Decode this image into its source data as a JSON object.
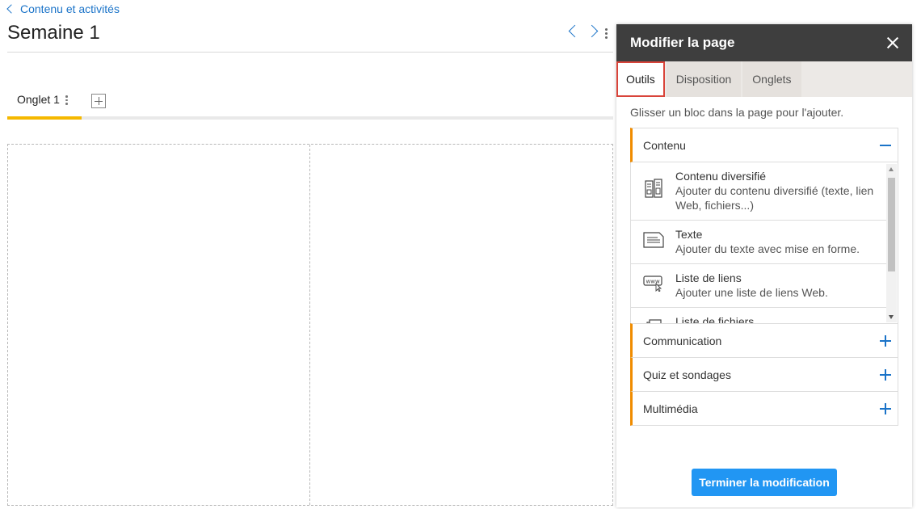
{
  "breadcrumb": {
    "label": "Contenu et activités"
  },
  "page": {
    "title": "Semaine 1"
  },
  "tabs": {
    "items": [
      {
        "label": "Onglet 1"
      }
    ]
  },
  "panel": {
    "title": "Modifier la page",
    "tabs": [
      {
        "label": "Outils",
        "active": true
      },
      {
        "label": "Disposition",
        "active": false
      },
      {
        "label": "Onglets",
        "active": false
      }
    ],
    "hint": "Glisser un bloc dans la page pour l'ajouter.",
    "sections": [
      {
        "label": "Contenu",
        "expanded": true
      },
      {
        "label": "Communication",
        "expanded": false
      },
      {
        "label": "Quiz et sondages",
        "expanded": false
      },
      {
        "label": "Multimédia",
        "expanded": false
      }
    ],
    "tools": [
      {
        "name": "Contenu diversifié",
        "desc": "Ajouter du contenu diversifié (texte, lien Web, fichiers...)",
        "icon": "mixed-content-icon"
      },
      {
        "name": "Texte",
        "desc": "Ajouter du texte avec mise en forme.",
        "icon": "text-icon"
      },
      {
        "name": "Liste de liens",
        "desc": "Ajouter une liste de liens Web.",
        "icon": "link-list-icon"
      },
      {
        "name": "Liste de fichiers",
        "desc": "",
        "icon": "file-list-icon"
      }
    ],
    "finish_label": "Terminer la modification"
  },
  "colors": {
    "accent": "#f08c00",
    "link": "#1a73c8",
    "tab_underline": "#f5b800",
    "button": "#2196f3",
    "header": "#3e3e3e",
    "active_tab_border": "#d9443a"
  }
}
